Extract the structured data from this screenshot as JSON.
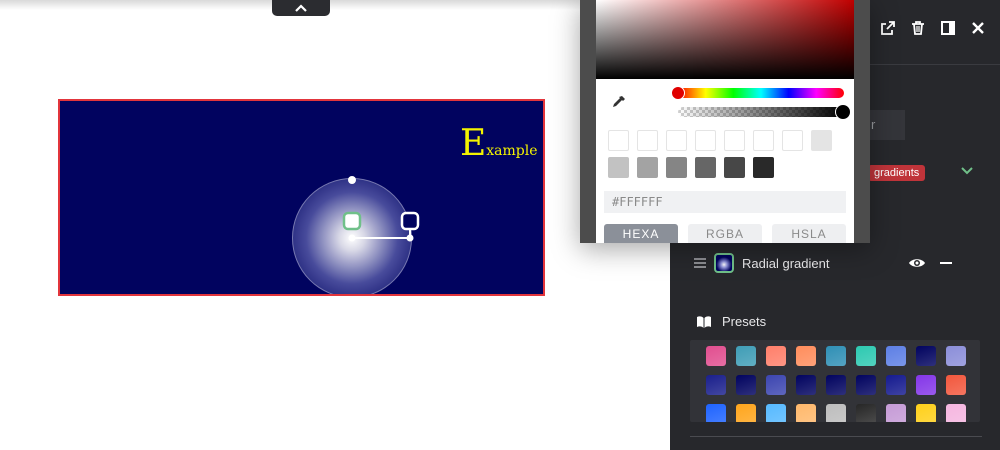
{
  "canvas": {
    "background": "#01035f",
    "border_color": "#e2353c",
    "example_text": {
      "first": "E",
      "rest": "xample",
      "color": "#f4f300"
    }
  },
  "panel": {
    "tab_fragment": "r",
    "badge": "gradients",
    "layer": {
      "label": "Radial gradient"
    },
    "presets_label": "Presets",
    "presets": [
      [
        "#e14e8f",
        "#3f9db6",
        "#ff7f6a",
        "#ff8d5c",
        "#2f8fb5",
        "#2dc9b1",
        "#5d7fe5",
        "#01035f",
        "#8b8ed9"
      ],
      [
        "#1a1f8c",
        "#01035f",
        "#3c45b0",
        "#01035f",
        "#01035f",
        "#01035f",
        "#151a8f",
        "#8436e8",
        "#f2573d"
      ],
      [
        "#1e63ff",
        "#ffa51c",
        "#56b9ff",
        "#ffb86b",
        "#bdbdbd",
        "#262626",
        "#c59ad6",
        "#ffd01a",
        "#f5b6e0"
      ]
    ]
  },
  "picker": {
    "hex_value": "#FFFFFF",
    "modes": [
      "HEXA",
      "RGBA",
      "HSLA"
    ],
    "active_mode": "HEXA",
    "hue_color": "#e00000",
    "swatch_rows": [
      [
        "#ffffff",
        "#ffffff",
        "#ffffff",
        "#ffffff",
        "#ffffff",
        "#ffffff",
        "#ffffff",
        "#e4e4e4"
      ],
      [
        "#c2c2c2",
        "#a3a3a3",
        "#858585",
        "#666666",
        "#474747",
        "#292929"
      ]
    ]
  }
}
